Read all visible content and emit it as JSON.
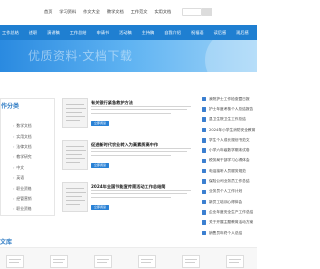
{
  "nav": {
    "items": [
      "首页",
      "学习资料",
      "作文大全",
      "教学文档",
      "工作范文",
      "实用文档"
    ]
  },
  "categories": [
    "工作总结",
    "述职",
    "演讲稿",
    "工作总结",
    "申请书",
    "活动稿",
    "主持稿",
    "自我介绍",
    "祝福语",
    "读后感",
    "观后感"
  ],
  "hero": {
    "title": "优质资料·文档下载"
  },
  "left_panel": {
    "title": "作分类",
    "items": [
      "数学文档",
      "实用文档",
      "法律文档",
      "教学研究",
      "中文",
      "英语",
      "职业资格",
      "经管营销",
      "职业资格",
      "自然科学",
      "计算机"
    ]
  },
  "articles": [
    {
      "title": "有关银行紧急救护方法",
      "button": "立即阅读"
    },
    {
      "title": "促进新时代农业转入为高素质高中作",
      "button": "立即阅读"
    },
    {
      "title": "2024年全国节能宣传周活动工作总结简",
      "button": "立即阅读"
    }
  ],
  "right_list": {
    "items": [
      "我院护士工作检查暨日报",
      "护士年度考核个人总结报告",
      "县卫生院卫生工作总结",
      "2024年小学生消防安全教育",
      "学生个人成长规划书范文",
      "小学六年级数学期末试卷",
      "税务局干部学习心得体会",
      "电话接听人员服务规范",
      "保险公司业务员工作总结",
      "业务员个人工作计划",
      "新员工培训心得体会",
      "企业年度安全生产工作总结",
      "关于开展主题教育活动方案",
      "销售员年终个人总结"
    ]
  },
  "bottom": {
    "title": "文库"
  },
  "colors": {
    "primary": "#1f7fd1",
    "accent_text": "#2e7bc4"
  }
}
